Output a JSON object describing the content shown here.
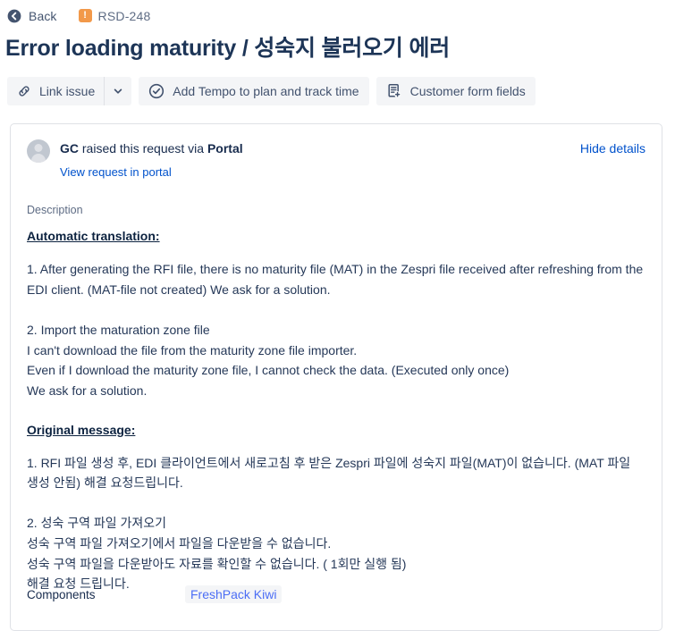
{
  "breadcrumb": {
    "back_label": "Back",
    "back_icon": "arrow-left-circle-icon",
    "issue_key": "RSD-248",
    "priority_icon": "priority-high-icon",
    "priority_color": "#F2994A",
    "priority_glyph": "!"
  },
  "header": {
    "title": "Error loading maturity / 성숙지 불러오기 에러"
  },
  "toolbar": {
    "link_issue_label": "Link issue",
    "link_issue_icon": "link-icon",
    "link_issue_caret_icon": "chevron-down-icon",
    "tempo_label": "Add Tempo to plan and track time",
    "tempo_icon": "check-circle-icon",
    "customer_form_label": "Customer form fields",
    "customer_form_icon": "form-add-icon"
  },
  "card": {
    "requester": {
      "reporter": "GC",
      "text_middle": " raised this request via ",
      "channel": "Portal",
      "avatar_icon": "user-avatar-icon",
      "portal_link_label": "View request in portal",
      "hide_details_label": "Hide details"
    },
    "description": {
      "field_label": "Description",
      "translation_heading": "Automatic translation:",
      "translation_paragraphs": [
        [
          "1. After generating the RFI file, there is no maturity file (MAT) in the Zespri file received after refreshing from the",
          "EDI client. (MAT-file not created) We ask for a solution."
        ],
        [
          "2. Import the maturation zone file",
          "I can't download the file from the maturity zone file importer.",
          "Even if I download the maturity zone file, I cannot check the data. (Executed only once)",
          "We ask for a solution."
        ]
      ],
      "original_heading": "Original message:",
      "original_paragraphs": [
        [
          "1. RFI 파일 생성 후, EDI 클라이언트에서 새로고침 후 받은 Zespri 파일에 성숙지 파일(MAT)이 없습니다. (MAT 파일",
          "생성 안됨) 해결 요청드립니다."
        ],
        [
          "2. 성숙 구역 파일 가져오기",
          "성숙 구역 파일 가져오기에서 파일을 다운받을 수 없습니다.",
          "성숙 구역 파일을 다운받아도 자료를 확인할 수 없습니다. ( 1회만 실행 됨)",
          "해결 요청 드립니다."
        ]
      ]
    },
    "components": {
      "label": "Components",
      "values": [
        "FreshPack Kiwi"
      ]
    }
  },
  "colors": {
    "link": "#0052CC",
    "title": "#1D3557",
    "body_text": "#253858",
    "muted_text": "#5E6C84",
    "card_border": "#DFE1E6",
    "button_bg": "#F4F5F7",
    "component_chip_text": "#4C6EF5"
  }
}
